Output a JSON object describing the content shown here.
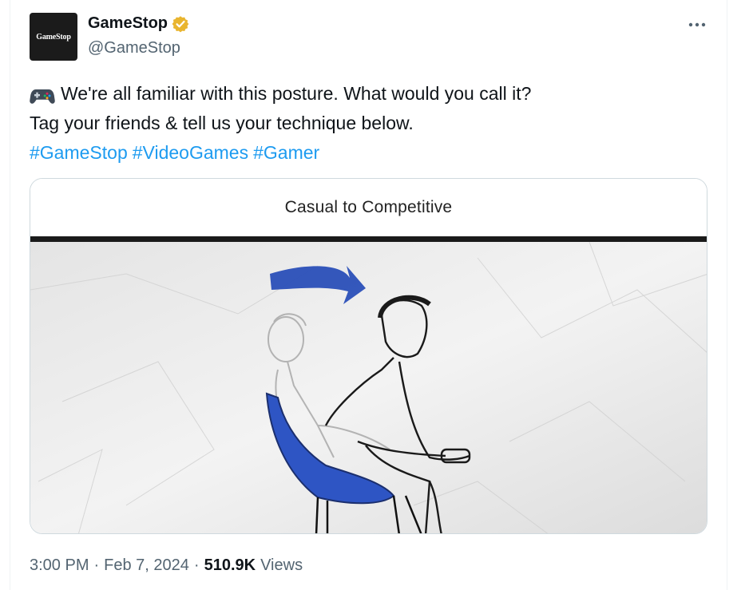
{
  "account": {
    "display_name": "GameStop",
    "handle": "@GameStop",
    "avatar_text": "GameStop",
    "verified": true,
    "verified_color": "#e9b52f"
  },
  "tweet": {
    "line1": "We're all familiar with this posture. What would you call it?",
    "line1_icon": "gamepad-icon",
    "line2": "Tag your friends & tell us your technique below.",
    "hashtags": [
      "#GameStop",
      "#VideoGames",
      "#Gamer"
    ]
  },
  "media": {
    "caption": "Casual to Competitive",
    "alt_subject": "sketch of a man shifting from a relaxed seated posture to leaning forward holding a controller, blue chair and blue arrow"
  },
  "meta": {
    "time": "3:00 PM",
    "date": "Feb 7, 2024",
    "separator": "·",
    "views_count": "510.9K",
    "views_label": "Views"
  },
  "colors": {
    "link": "#1d9bf0",
    "text": "#0f1419",
    "muted": "#536471",
    "accent_blue_art": "#2a4fb8"
  }
}
